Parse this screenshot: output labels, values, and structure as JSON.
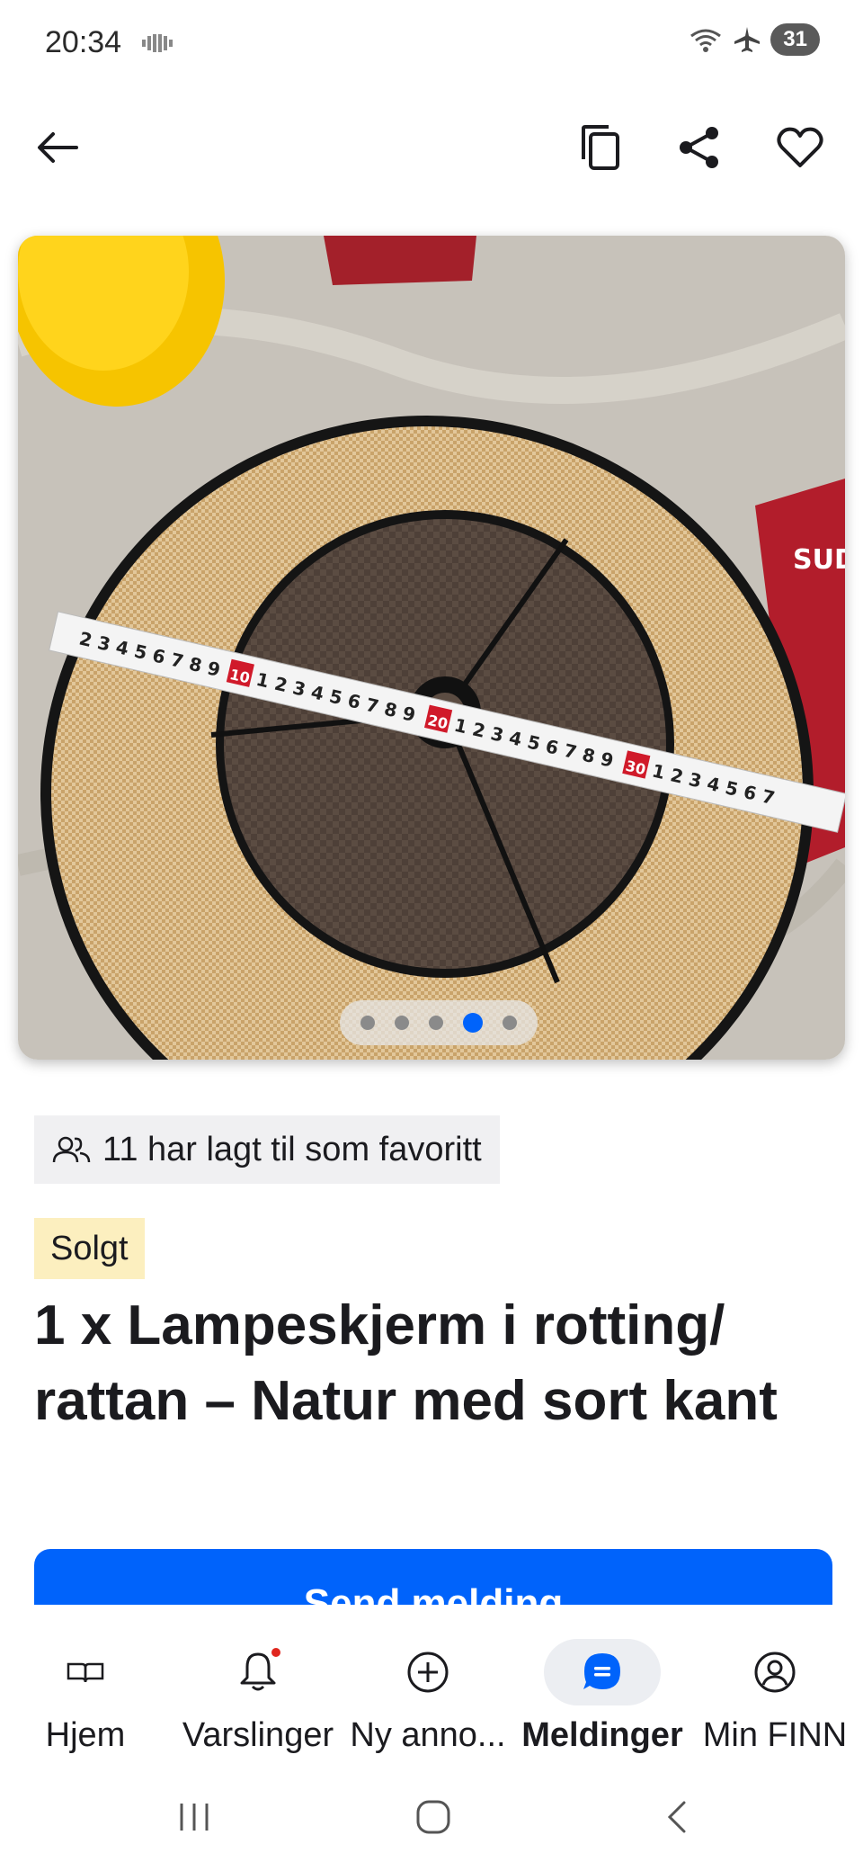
{
  "status_bar": {
    "time": "20:34",
    "battery": "31",
    "icons": [
      "wifi-icon",
      "airplane-icon",
      "battery-icon"
    ]
  },
  "top_bar": {
    "icons": [
      "back-arrow-icon",
      "copy-icon",
      "share-icon",
      "heart-icon"
    ]
  },
  "gallery": {
    "image_count": 5,
    "active_index": 4,
    "accent": "#0063fb"
  },
  "favorites": {
    "text": "11 har lagt til som favoritt"
  },
  "status_badge": "Solgt",
  "title": "1 x Lampeskjerm i rotting/ rattan – Natur med sort kant",
  "send_button_label": "Send melding",
  "bottom_nav": {
    "items": [
      {
        "label": "Hjem",
        "icon": "book-icon",
        "active": false
      },
      {
        "label": "Varslinger",
        "icon": "bell-icon",
        "active": false
      },
      {
        "label": "Ny anno...",
        "icon": "plus-circle-icon",
        "active": false
      },
      {
        "label": "Meldinger",
        "icon": "chat-icon",
        "active": true
      },
      {
        "label": "Min FINN",
        "icon": "user-circle-icon",
        "active": false
      }
    ]
  },
  "colors": {
    "primary": "#0063fb",
    "sold_badge_bg": "#fcefbf",
    "chip_bg": "#f0f0f2",
    "notification": "#e0261e"
  }
}
